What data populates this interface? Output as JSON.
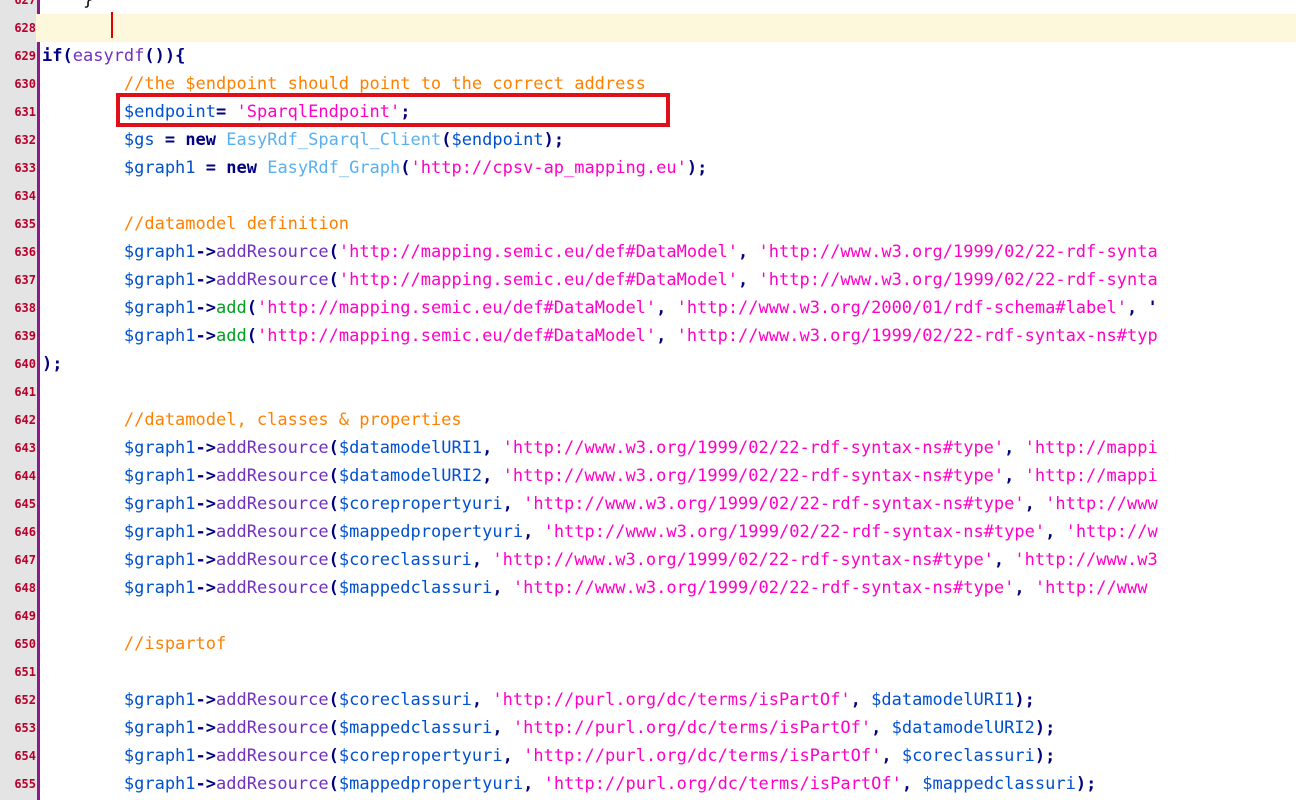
{
  "colors": {
    "default": "#000000",
    "var": "#0050d0",
    "string": "#ff00c8",
    "comment": "#ff8000",
    "keyword": "#000080",
    "arrow": "#000080",
    "class": "#59b0f0",
    "func": "#7030c0",
    "method": "#00a020",
    "op": "#000080",
    "line_number": "#b8002b",
    "current_line_bg": "#fdf8dc",
    "highlight_box": "#e0101a",
    "fold_bar": "#8b1b8b"
  },
  "editor": {
    "current_line": "628",
    "highlighted_line": "631",
    "lines": [
      {
        "num": "627",
        "tokens": [
          {
            "t": "default",
            "v": "    }"
          }
        ]
      },
      {
        "num": "628",
        "tokens": []
      },
      {
        "num": "629",
        "tokens": [
          {
            "t": "keyword",
            "v": "if"
          },
          {
            "t": "op",
            "v": "("
          },
          {
            "t": "func",
            "v": "easyrdf"
          },
          {
            "t": "op",
            "v": "()){"
          }
        ]
      },
      {
        "num": "630",
        "tokens": [
          {
            "t": "comment",
            "v": "        //the $endpoint should point to the correct address"
          }
        ]
      },
      {
        "num": "631",
        "tokens": [
          {
            "t": "var",
            "v": "        $endpoint"
          },
          {
            "t": "op",
            "v": "= "
          },
          {
            "t": "string",
            "v": "'SparqlEndpoint'"
          },
          {
            "t": "op",
            "v": ";"
          }
        ]
      },
      {
        "num": "632",
        "tokens": [
          {
            "t": "var",
            "v": "        $gs"
          },
          {
            "t": "op",
            "v": " = "
          },
          {
            "t": "keyword",
            "v": "new "
          },
          {
            "t": "class",
            "v": "EasyRdf_Sparql_Client"
          },
          {
            "t": "op",
            "v": "("
          },
          {
            "t": "var",
            "v": "$endpoint"
          },
          {
            "t": "op",
            "v": ");"
          }
        ]
      },
      {
        "num": "633",
        "tokens": [
          {
            "t": "var",
            "v": "        $graph1"
          },
          {
            "t": "op",
            "v": " = "
          },
          {
            "t": "keyword",
            "v": "new "
          },
          {
            "t": "class",
            "v": "EasyRdf_Graph"
          },
          {
            "t": "op",
            "v": "("
          },
          {
            "t": "string",
            "v": "'http://cpsv-ap_mapping.eu'"
          },
          {
            "t": "op",
            "v": ");"
          }
        ]
      },
      {
        "num": "634",
        "tokens": []
      },
      {
        "num": "635",
        "tokens": [
          {
            "t": "comment",
            "v": "        //datamodel definition"
          }
        ]
      },
      {
        "num": "636",
        "tokens": [
          {
            "t": "var",
            "v": "        $graph1"
          },
          {
            "t": "arrow",
            "v": "->"
          },
          {
            "t": "func",
            "v": "addResource"
          },
          {
            "t": "op",
            "v": "("
          },
          {
            "t": "string",
            "v": "'http://mapping.semic.eu/def#DataModel'"
          },
          {
            "t": "op",
            "v": ", "
          },
          {
            "t": "string",
            "v": "'http://www.w3.org/1999/02/22-rdf-synta"
          }
        ]
      },
      {
        "num": "637",
        "tokens": [
          {
            "t": "var",
            "v": "        $graph1"
          },
          {
            "t": "arrow",
            "v": "->"
          },
          {
            "t": "func",
            "v": "addResource"
          },
          {
            "t": "op",
            "v": "("
          },
          {
            "t": "string",
            "v": "'http://mapping.semic.eu/def#DataModel'"
          },
          {
            "t": "op",
            "v": ", "
          },
          {
            "t": "string",
            "v": "'http://www.w3.org/1999/02/22-rdf-synta"
          }
        ]
      },
      {
        "num": "638",
        "tokens": [
          {
            "t": "var",
            "v": "        $graph1"
          },
          {
            "t": "arrow",
            "v": "->"
          },
          {
            "t": "method",
            "v": "add"
          },
          {
            "t": "op",
            "v": "("
          },
          {
            "t": "string",
            "v": "'http://mapping.semic.eu/def#DataModel'"
          },
          {
            "t": "op",
            "v": ", "
          },
          {
            "t": "string",
            "v": "'http://www.w3.org/2000/01/rdf-schema#label'"
          },
          {
            "t": "op",
            "v": ", '"
          }
        ]
      },
      {
        "num": "639",
        "tokens": [
          {
            "t": "var",
            "v": "        $graph1"
          },
          {
            "t": "arrow",
            "v": "->"
          },
          {
            "t": "method",
            "v": "add"
          },
          {
            "t": "op",
            "v": "("
          },
          {
            "t": "string",
            "v": "'http://mapping.semic.eu/def#DataModel'"
          },
          {
            "t": "op",
            "v": ", "
          },
          {
            "t": "string",
            "v": "'http://www.w3.org/1999/02/22-rdf-syntax-ns#typ"
          }
        ]
      },
      {
        "num": "640",
        "tokens": [
          {
            "t": "op",
            "v": ");"
          }
        ]
      },
      {
        "num": "641",
        "tokens": []
      },
      {
        "num": "642",
        "tokens": [
          {
            "t": "comment",
            "v": "        //datamodel, classes & properties"
          }
        ]
      },
      {
        "num": "643",
        "tokens": [
          {
            "t": "var",
            "v": "        $graph1"
          },
          {
            "t": "arrow",
            "v": "->"
          },
          {
            "t": "func",
            "v": "addResource"
          },
          {
            "t": "op",
            "v": "("
          },
          {
            "t": "var",
            "v": "$datamodelURI1"
          },
          {
            "t": "op",
            "v": ", "
          },
          {
            "t": "string",
            "v": "'http://www.w3.org/1999/02/22-rdf-syntax-ns#type'"
          },
          {
            "t": "op",
            "v": ", "
          },
          {
            "t": "string",
            "v": "'http://mappi"
          }
        ]
      },
      {
        "num": "644",
        "tokens": [
          {
            "t": "var",
            "v": "        $graph1"
          },
          {
            "t": "arrow",
            "v": "->"
          },
          {
            "t": "func",
            "v": "addResource"
          },
          {
            "t": "op",
            "v": "("
          },
          {
            "t": "var",
            "v": "$datamodelURI2"
          },
          {
            "t": "op",
            "v": ", "
          },
          {
            "t": "string",
            "v": "'http://www.w3.org/1999/02/22-rdf-syntax-ns#type'"
          },
          {
            "t": "op",
            "v": ", "
          },
          {
            "t": "string",
            "v": "'http://mappi"
          }
        ]
      },
      {
        "num": "645",
        "tokens": [
          {
            "t": "var",
            "v": "        $graph1"
          },
          {
            "t": "arrow",
            "v": "->"
          },
          {
            "t": "func",
            "v": "addResource"
          },
          {
            "t": "op",
            "v": "("
          },
          {
            "t": "var",
            "v": "$corepropertyuri"
          },
          {
            "t": "op",
            "v": ", "
          },
          {
            "t": "string",
            "v": "'http://www.w3.org/1999/02/22-rdf-syntax-ns#type'"
          },
          {
            "t": "op",
            "v": ", "
          },
          {
            "t": "string",
            "v": "'http://www"
          }
        ]
      },
      {
        "num": "646",
        "tokens": [
          {
            "t": "var",
            "v": "        $graph1"
          },
          {
            "t": "arrow",
            "v": "->"
          },
          {
            "t": "func",
            "v": "addResource"
          },
          {
            "t": "op",
            "v": "("
          },
          {
            "t": "var",
            "v": "$mappedpropertyuri"
          },
          {
            "t": "op",
            "v": ", "
          },
          {
            "t": "string",
            "v": "'http://www.w3.org/1999/02/22-rdf-syntax-ns#type'"
          },
          {
            "t": "op",
            "v": ", "
          },
          {
            "t": "string",
            "v": "'http://w"
          }
        ]
      },
      {
        "num": "647",
        "tokens": [
          {
            "t": "var",
            "v": "        $graph1"
          },
          {
            "t": "arrow",
            "v": "->"
          },
          {
            "t": "func",
            "v": "addResource"
          },
          {
            "t": "op",
            "v": "("
          },
          {
            "t": "var",
            "v": "$coreclassuri"
          },
          {
            "t": "op",
            "v": ", "
          },
          {
            "t": "string",
            "v": "'http://www.w3.org/1999/02/22-rdf-syntax-ns#type'"
          },
          {
            "t": "op",
            "v": ", "
          },
          {
            "t": "string",
            "v": "'http://www.w3"
          }
        ]
      },
      {
        "num": "648",
        "tokens": [
          {
            "t": "var",
            "v": "        $graph1"
          },
          {
            "t": "arrow",
            "v": "->"
          },
          {
            "t": "func",
            "v": "addResource"
          },
          {
            "t": "op",
            "v": "("
          },
          {
            "t": "var",
            "v": "$mappedclassuri"
          },
          {
            "t": "op",
            "v": ", "
          },
          {
            "t": "string",
            "v": "'http://www.w3.org/1999/02/22-rdf-syntax-ns#type'"
          },
          {
            "t": "op",
            "v": ", "
          },
          {
            "t": "string",
            "v": "'http://www"
          }
        ]
      },
      {
        "num": "649",
        "tokens": []
      },
      {
        "num": "650",
        "tokens": [
          {
            "t": "comment",
            "v": "        //ispartof"
          }
        ]
      },
      {
        "num": "651",
        "tokens": []
      },
      {
        "num": "652",
        "tokens": [
          {
            "t": "var",
            "v": "        $graph1"
          },
          {
            "t": "arrow",
            "v": "->"
          },
          {
            "t": "func",
            "v": "addResource"
          },
          {
            "t": "op",
            "v": "("
          },
          {
            "t": "var",
            "v": "$coreclassuri"
          },
          {
            "t": "op",
            "v": ", "
          },
          {
            "t": "string",
            "v": "'http://purl.org/dc/terms/isPartOf'"
          },
          {
            "t": "op",
            "v": ", "
          },
          {
            "t": "var",
            "v": "$datamodelURI1"
          },
          {
            "t": "op",
            "v": ");"
          }
        ]
      },
      {
        "num": "653",
        "tokens": [
          {
            "t": "var",
            "v": "        $graph1"
          },
          {
            "t": "arrow",
            "v": "->"
          },
          {
            "t": "func",
            "v": "addResource"
          },
          {
            "t": "op",
            "v": "("
          },
          {
            "t": "var",
            "v": "$mappedclassuri"
          },
          {
            "t": "op",
            "v": ", "
          },
          {
            "t": "string",
            "v": "'http://purl.org/dc/terms/isPartOf'"
          },
          {
            "t": "op",
            "v": ", "
          },
          {
            "t": "var",
            "v": "$datamodelURI2"
          },
          {
            "t": "op",
            "v": ");"
          }
        ]
      },
      {
        "num": "654",
        "tokens": [
          {
            "t": "var",
            "v": "        $graph1"
          },
          {
            "t": "arrow",
            "v": "->"
          },
          {
            "t": "func",
            "v": "addResource"
          },
          {
            "t": "op",
            "v": "("
          },
          {
            "t": "var",
            "v": "$corepropertyuri"
          },
          {
            "t": "op",
            "v": ", "
          },
          {
            "t": "string",
            "v": "'http://purl.org/dc/terms/isPartOf'"
          },
          {
            "t": "op",
            "v": ", "
          },
          {
            "t": "var",
            "v": "$coreclassuri"
          },
          {
            "t": "op",
            "v": ");"
          }
        ]
      },
      {
        "num": "655",
        "tokens": [
          {
            "t": "var",
            "v": "        $graph1"
          },
          {
            "t": "arrow",
            "v": "->"
          },
          {
            "t": "func",
            "v": "addResource"
          },
          {
            "t": "op",
            "v": "("
          },
          {
            "t": "var",
            "v": "$mappedpropertyuri"
          },
          {
            "t": "op",
            "v": ", "
          },
          {
            "t": "string",
            "v": "'http://purl.org/dc/terms/isPartOf'"
          },
          {
            "t": "op",
            "v": ", "
          },
          {
            "t": "var",
            "v": "$mappedclassuri"
          },
          {
            "t": "op",
            "v": ");"
          }
        ]
      }
    ]
  }
}
